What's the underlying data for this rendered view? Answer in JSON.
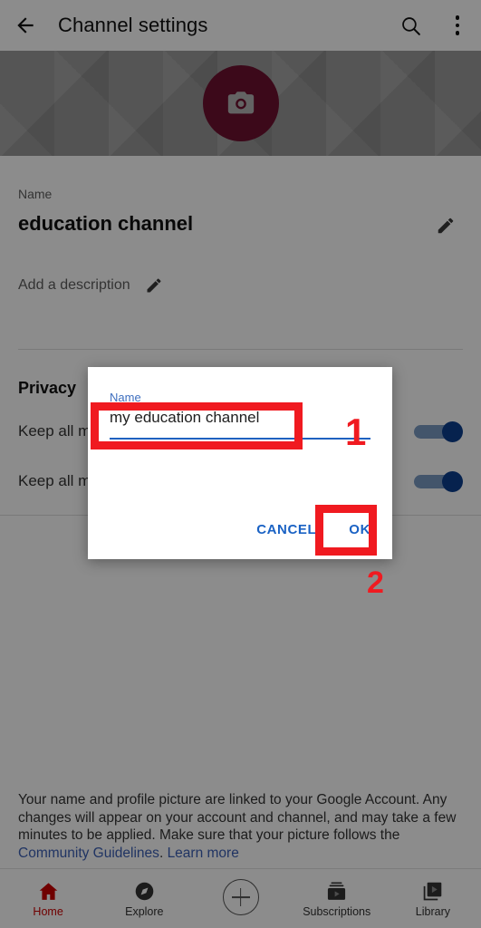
{
  "header": {
    "back_icon": "back-arrow-icon",
    "title": "Channel settings",
    "search_icon": "search-icon",
    "overflow_icon": "more-vertical-icon"
  },
  "banner": {
    "avatar_icon": "camera-icon",
    "avatar_color": "#6e1230"
  },
  "profile": {
    "name_label": "Name",
    "channel_name": "education channel",
    "name_edit_icon": "pencil-icon",
    "description_placeholder": "Add a description",
    "description_edit_icon": "pencil-icon"
  },
  "privacy": {
    "title": "Privacy",
    "rows": [
      {
        "label": "Keep all m",
        "toggle_on": true
      },
      {
        "label": "Keep all m",
        "toggle_on": true
      }
    ]
  },
  "footer": {
    "text_part_1": "Your name and profile picture are linked to your Google Account. Any changes will appear on your account and channel, and may take a few minutes to be applied. Make sure that your picture follows the ",
    "link_community": "Community Guidelines",
    "text_part_2": ". ",
    "link_learn_more": "Learn more"
  },
  "bottom_nav": {
    "items": [
      {
        "label": "Home",
        "icon": "home-icon",
        "active": true
      },
      {
        "label": "Explore",
        "icon": "compass-icon",
        "active": false
      },
      {
        "label": "",
        "icon": "plus-circle-icon",
        "active": false
      },
      {
        "label": "Subscriptions",
        "icon": "subscriptions-icon",
        "active": false
      },
      {
        "label": "Library",
        "icon": "library-icon",
        "active": false
      }
    ]
  },
  "dialog": {
    "field_label": "Name",
    "input_value": "my education channel",
    "input_placeholder": "Name",
    "cancel_label": "CANCEL",
    "ok_label": "OK"
  },
  "annotations": {
    "color": "#f01a20",
    "step_1": "1",
    "step_2": "2"
  }
}
